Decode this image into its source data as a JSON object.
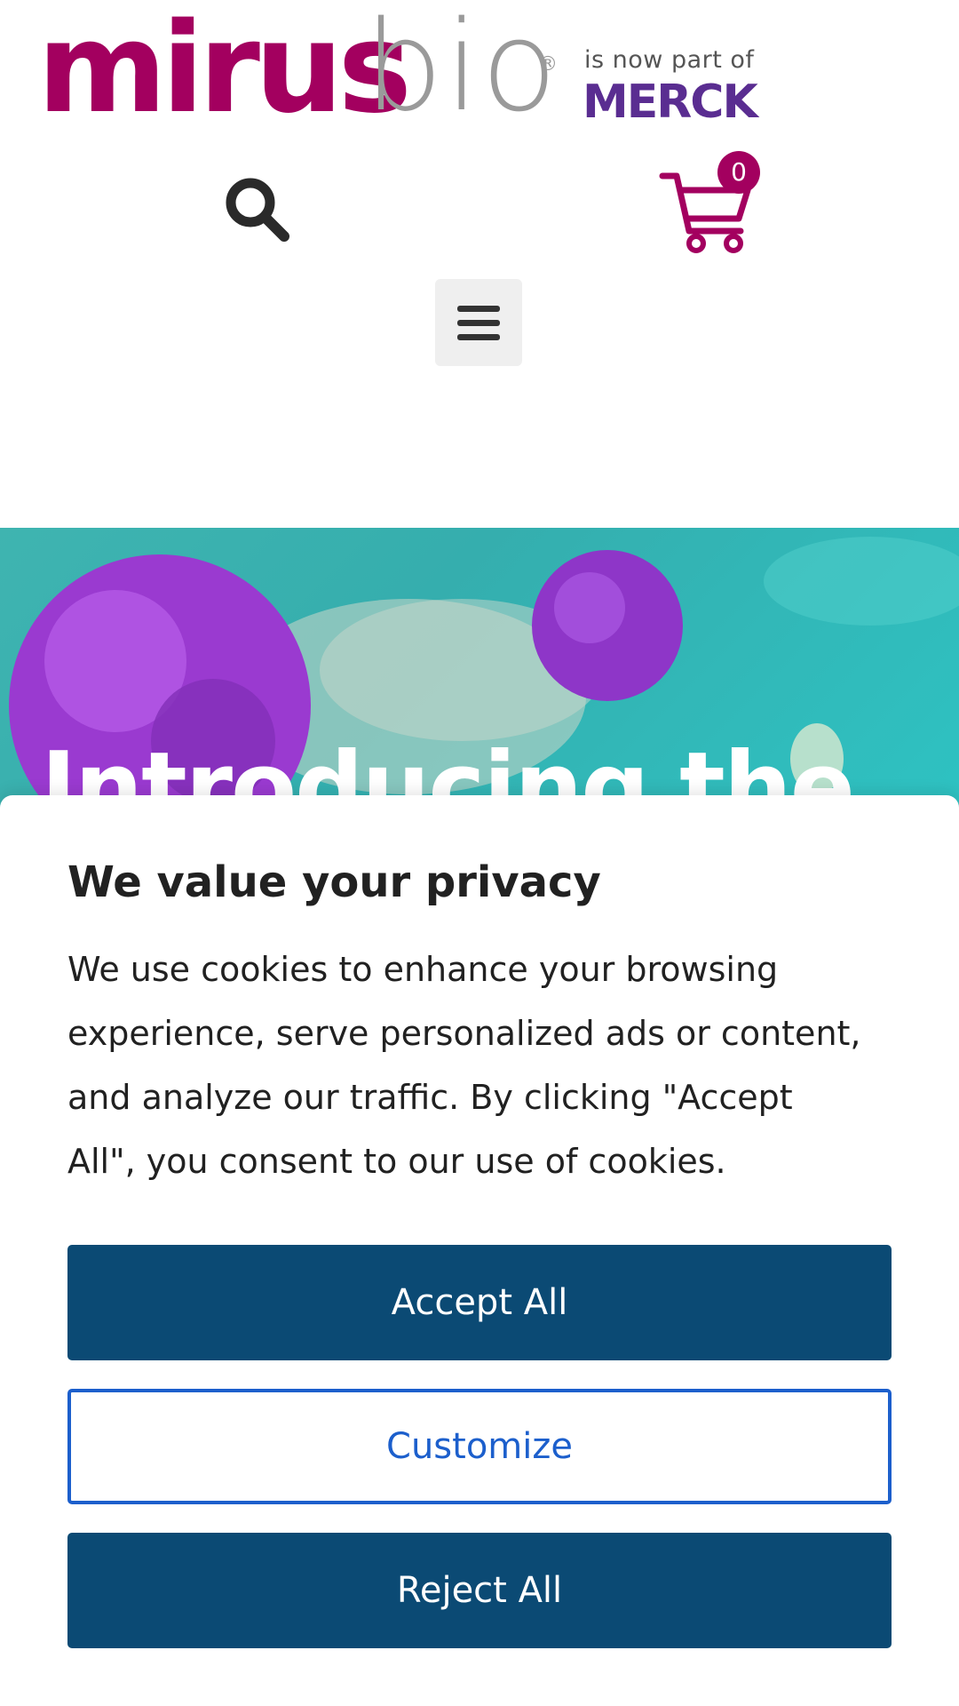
{
  "header": {
    "logo_main": "mirus",
    "logo_secondary": "bio",
    "logo_registered": "®",
    "partof_text": "is now part of",
    "partner_logo": "MERCK",
    "search_icon": "search-icon",
    "cart_icon": "shopping-cart-icon",
    "cart_count": "0",
    "menu_icon": "hamburger-menu-icon"
  },
  "hero": {
    "title": "Introducing the"
  },
  "cookie_banner": {
    "title": "We value your privacy",
    "text": "We use cookies to enhance your browsing experience, serve personalized ads or content, and analyze our traffic. By clicking \"Accept All\", you consent to our use of cookies.",
    "accept_label": "Accept All",
    "customize_label": "Customize",
    "reject_label": "Reject All"
  },
  "colors": {
    "brand": "#a3005f",
    "merck": "#5a2d91",
    "primary_button": "#0b4a74",
    "secondary_button": "#1c5fcc"
  }
}
